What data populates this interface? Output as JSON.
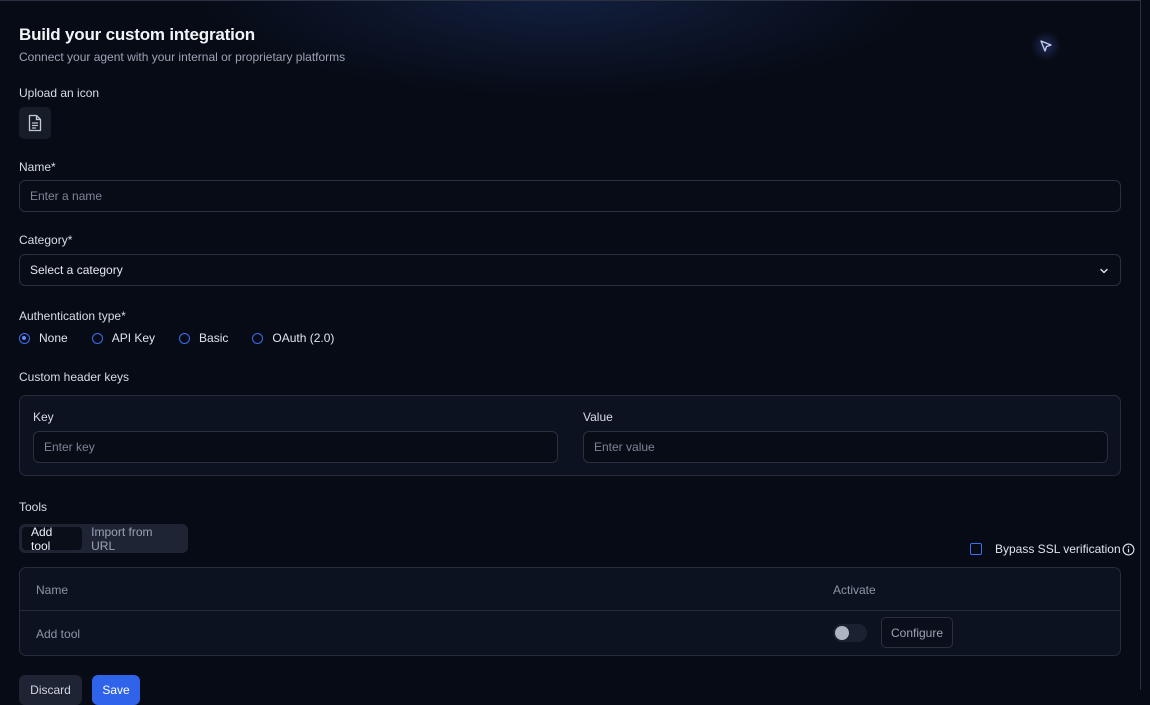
{
  "header": {
    "title": "Build your custom integration",
    "subtitle": "Connect your agent with your internal or proprietary platforms",
    "send_icon": "send-icon"
  },
  "upload": {
    "label": "Upload an icon",
    "icon": "document-icon"
  },
  "name": {
    "label": "Name*",
    "placeholder": "Enter a name",
    "value": ""
  },
  "category": {
    "label": "Category*",
    "selected": "Select a category",
    "icon": "chevron-down-icon"
  },
  "auth": {
    "label": "Authentication type*",
    "options": [
      "None",
      "API Key",
      "Basic",
      "OAuth (2.0)"
    ],
    "selected": "None"
  },
  "custom_headers": {
    "label": "Custom header keys",
    "key_label": "Key",
    "key_placeholder": "Enter key",
    "value_label": "Value",
    "value_placeholder": "Enter value"
  },
  "tools": {
    "label": "Tools",
    "tabs": [
      "Add tool",
      "Import from URL"
    ],
    "active_tab": "Add tool",
    "bypass_ssl_label": "Bypass SSL verification",
    "bypass_ssl_checked": false,
    "table": {
      "columns": [
        "Name",
        "Activate"
      ],
      "rows": [
        {
          "name": "Add tool",
          "active": false,
          "action": "Configure"
        }
      ]
    }
  },
  "footer": {
    "discard_label": "Discard",
    "save_label": "Save"
  },
  "colors": {
    "accent": "#2f63ea",
    "background": "#070b16",
    "panel": "#0d1220"
  }
}
